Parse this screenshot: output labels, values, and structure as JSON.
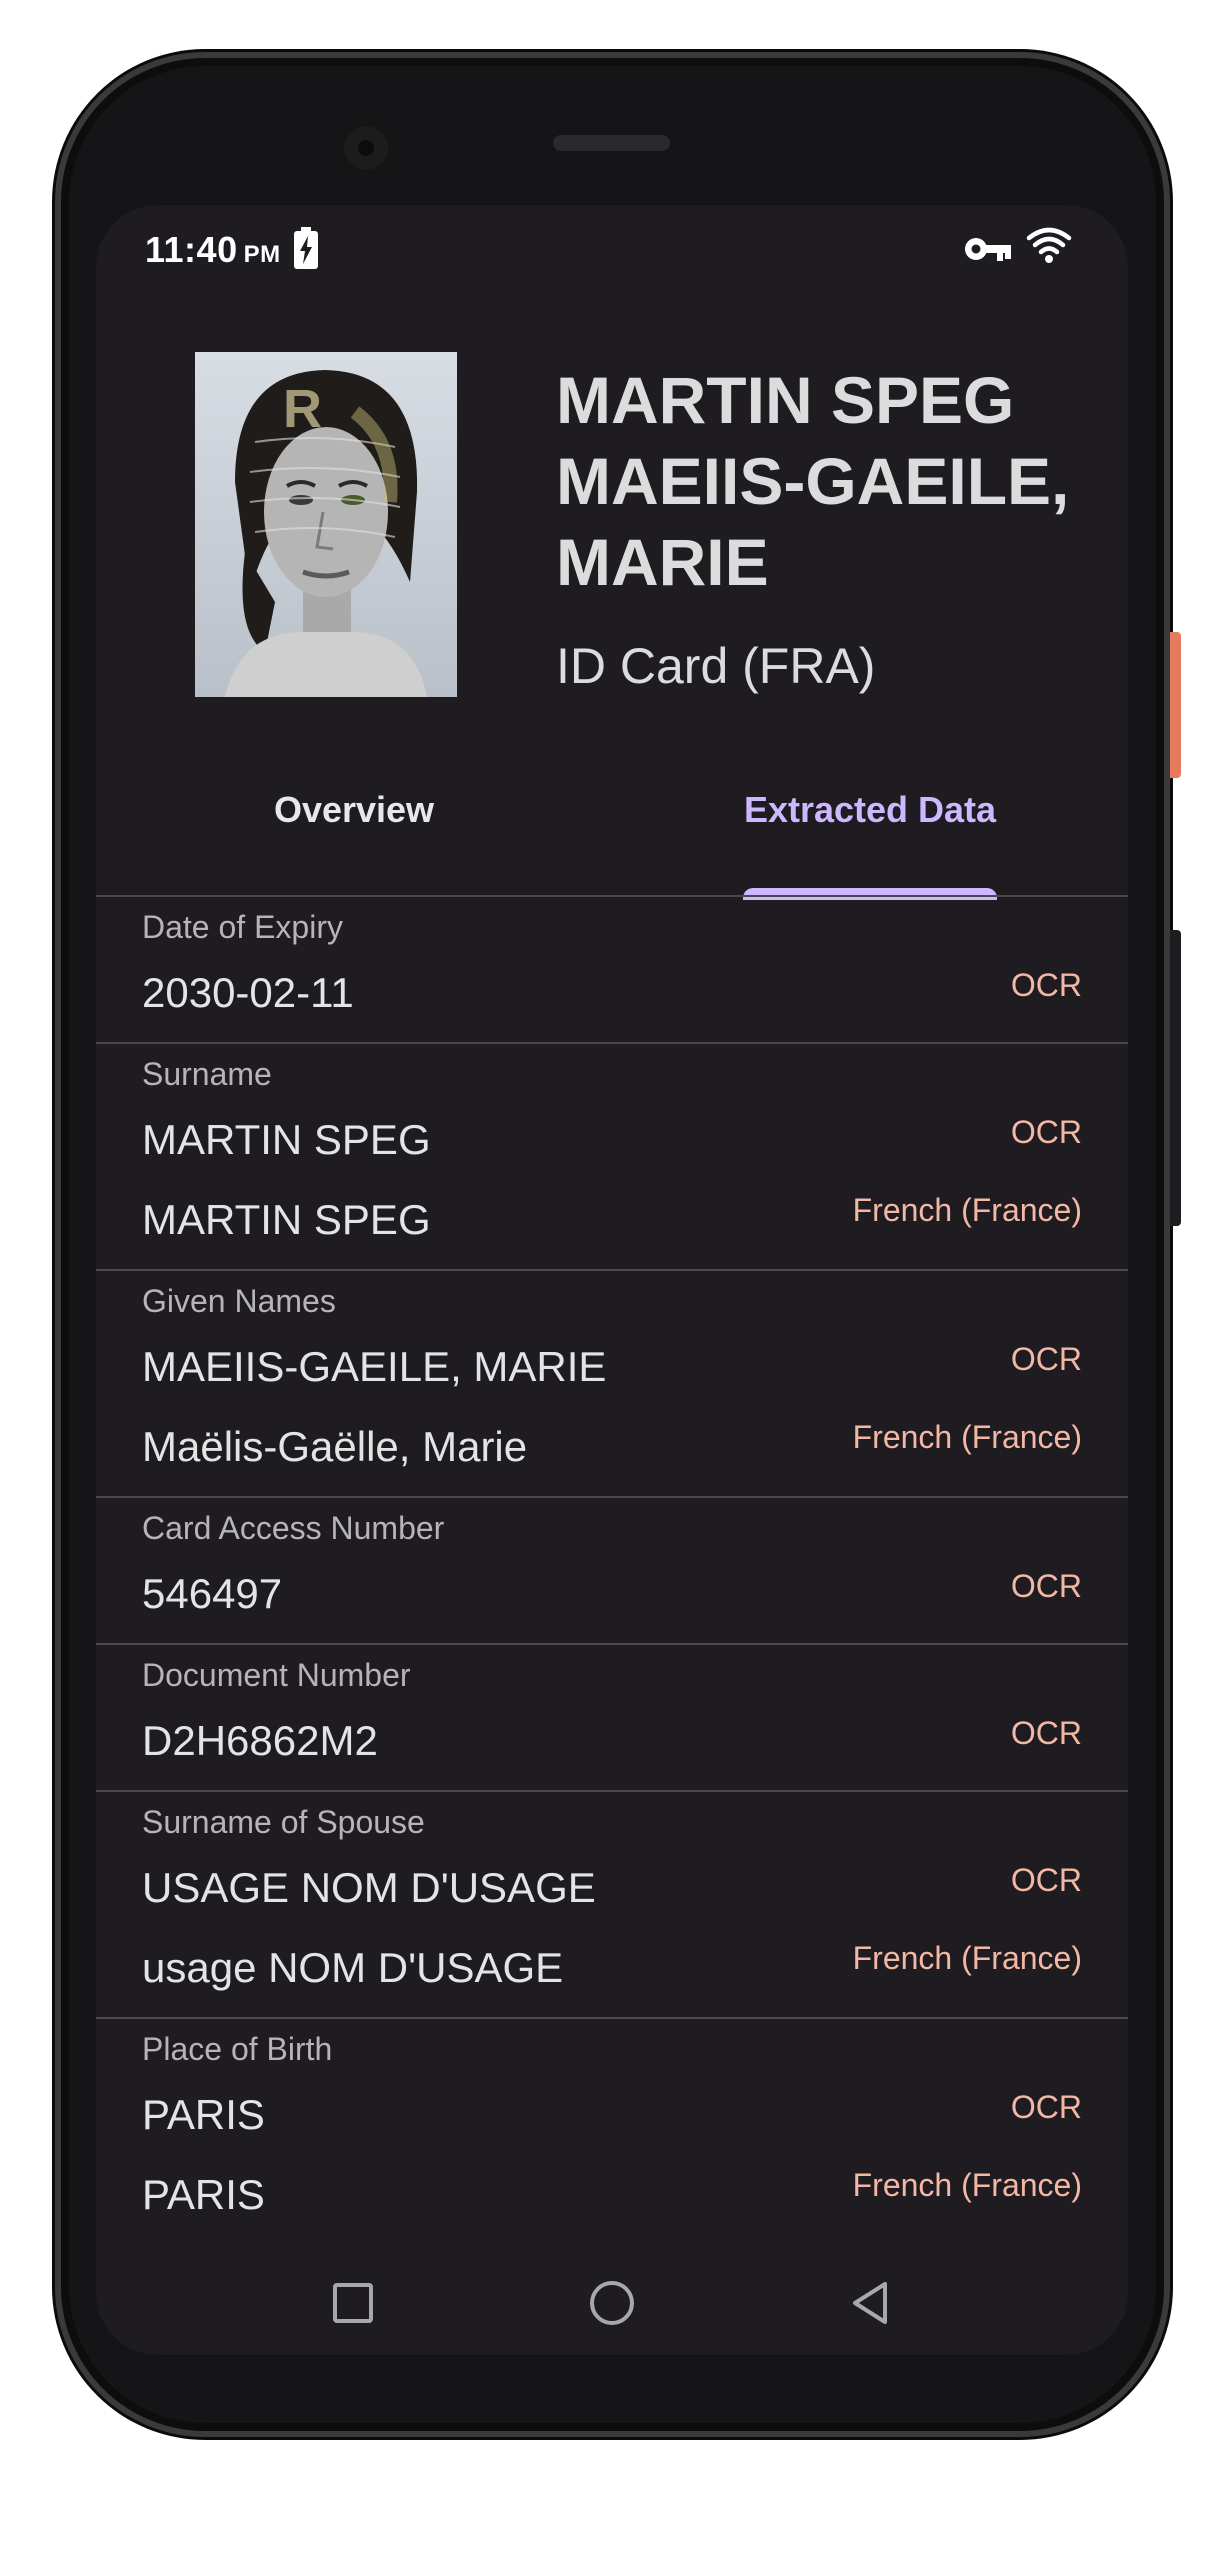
{
  "status_bar": {
    "time": "11:40",
    "ampm": "PM",
    "icons": [
      "battery-charging-icon",
      "vpn-key-icon",
      "wifi-icon"
    ]
  },
  "header": {
    "name_line1": "MARTIN SPEG",
    "name_line2": "MAEIIS-GAEILE,",
    "name_line3": "MARIE",
    "document_type": "ID Card (FRA)",
    "photo": "portrait-photo"
  },
  "tabs": [
    {
      "label": "Overview",
      "selected": false
    },
    {
      "label": "Extracted Data",
      "selected": true
    }
  ],
  "fields": [
    {
      "label": "Date of Expiry",
      "values": [
        {
          "value": "2030-02-11",
          "source": "OCR"
        }
      ]
    },
    {
      "label": "Surname",
      "values": [
        {
          "value": "MARTIN SPEG",
          "source": "OCR"
        },
        {
          "value": "MARTIN SPEG",
          "source": "French (France)"
        }
      ]
    },
    {
      "label": "Given Names",
      "values": [
        {
          "value": "MAEIIS-GAEILE, MARIE",
          "source": "OCR"
        },
        {
          "value": "Maëlis-Gaëlle, Marie",
          "source": "French (France)"
        }
      ]
    },
    {
      "label": "Card Access Number",
      "values": [
        {
          "value": "546497",
          "source": "OCR"
        }
      ]
    },
    {
      "label": "Document Number",
      "values": [
        {
          "value": "D2H6862M2",
          "source": "OCR"
        }
      ]
    },
    {
      "label": "Surname of Spouse",
      "values": [
        {
          "value": "USAGE NOM D'USAGE",
          "source": "OCR"
        },
        {
          "value": "usage NOM D'USAGE",
          "source": "French (France)"
        }
      ]
    },
    {
      "label": "Place of Birth",
      "values": [
        {
          "value": "PARIS",
          "source": "OCR"
        },
        {
          "value": "PARIS",
          "source": "French (France)"
        }
      ]
    }
  ],
  "nav_bar": [
    "recents-square-icon",
    "home-circle-icon",
    "back-triangle-icon"
  ],
  "colors": {
    "background": "#1e1c20",
    "accent": "#cdb8ff",
    "source_text": "#f2b7a5",
    "divider": "#4a484e"
  }
}
